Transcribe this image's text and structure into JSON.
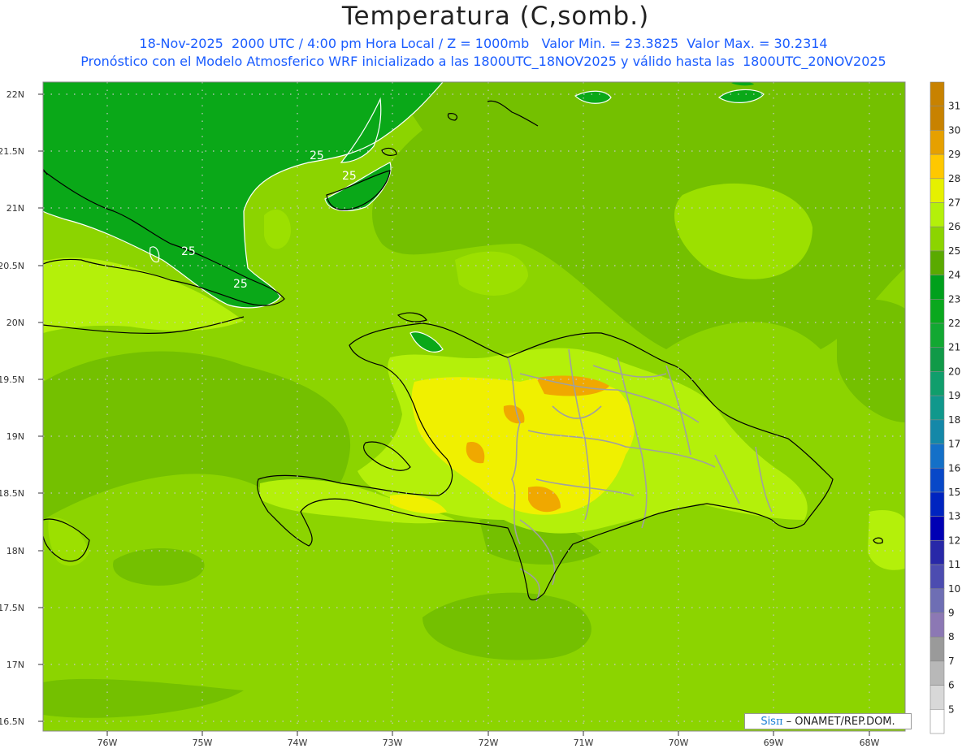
{
  "header": {
    "title": "Temperatura (C,somb.)",
    "subtitle1": "18-Nov-2025  2000 UTC / 4:00 pm Hora Local / Z = 1000mb   Valor Min. = 23.3825  Valor Max. = 30.2314",
    "subtitle2": "Pronóstico con el Modelo Atmosferico WRF inicializado a las 1800UTC_18NOV2025 y válido hasta las  1800UTC_20NOV2025"
  },
  "credit": {
    "brand_prefix": "Sis",
    "brand_pi": "π",
    "text": "– ONAMET/REP.DOM."
  },
  "axes": {
    "lat_labels": [
      "22N",
      "21.5N",
      "21N",
      "20.5N",
      "20N",
      "19.5N",
      "19N",
      "18.5N",
      "18N",
      "17.5N",
      "17N",
      "16.5N"
    ],
    "lon_labels": [
      "76W",
      "75W",
      "74W",
      "73W",
      "72W",
      "71W",
      "70W",
      "69W",
      "68W"
    ]
  },
  "contour_labels": [
    "25",
    "25",
    "25",
    "25"
  ],
  "colorbar": {
    "levels": [
      "5",
      "6",
      "7",
      "8",
      "9",
      "10",
      "11",
      "12",
      "13",
      "15",
      "16",
      "17",
      "18",
      "19",
      "20",
      "21",
      "22",
      "23",
      "24",
      "25",
      "26",
      "27",
      "28",
      "29",
      "30",
      "31"
    ],
    "colors": [
      "#ffffff",
      "#d8d8d8",
      "#b8b8b8",
      "#9a9a9a",
      "#8c78b4",
      "#6e6eb4",
      "#4c4cb0",
      "#2828a8",
      "#0000b4",
      "#0024c0",
      "#0848c8",
      "#1470c8",
      "#1488a8",
      "#10988c",
      "#109e6c",
      "#109a48",
      "#12a832",
      "#0aa81e",
      "#00a01c",
      "#5aaa00",
      "#8cd400",
      "#b4f00a",
      "#e6f000",
      "#ffc800",
      "#e6a000",
      "#c88200"
    ],
    "top_color": "#c88200"
  },
  "legend_colors": {
    "dark_green": "#0aa818",
    "base_green": "#8cd400",
    "olive_green": "#6cb800",
    "light_green": "#b4f00a",
    "yellow": "#f0f000",
    "orange": "#f0a800",
    "coast": "#000000",
    "borders": "#a0a0a0",
    "contour": "#ffffff",
    "grid": "#c8c8c8"
  }
}
